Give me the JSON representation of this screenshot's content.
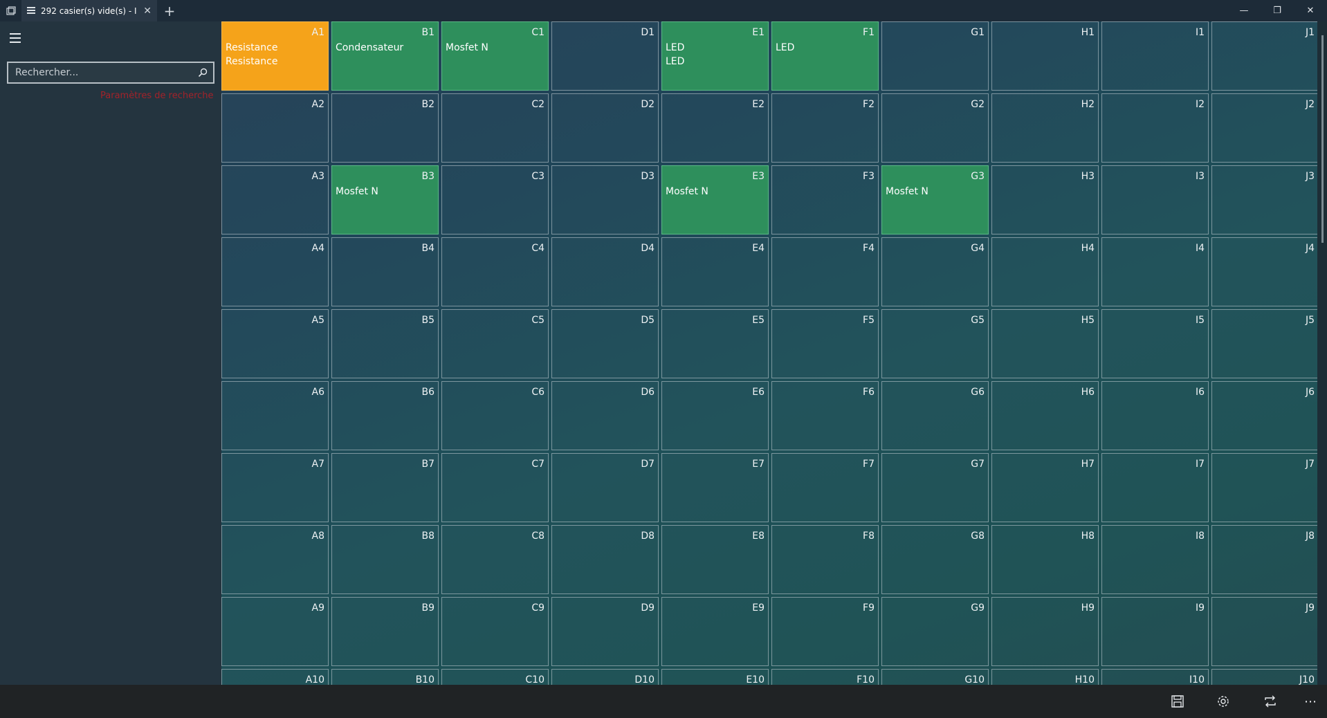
{
  "tab": {
    "title": "292 casier(s) vide(s) - I",
    "close_icon": "close-icon",
    "new_tab_icon": "plus-icon"
  },
  "window": {
    "minimize": "—",
    "restore": "❐",
    "close": "✕"
  },
  "sidebar": {
    "menu_icon": "hamburger-icon",
    "search_placeholder": "Rechercher...",
    "search_icon": "search-icon",
    "search_hint": "Paramètres de recherche"
  },
  "colors": {
    "occupied": "#2e8f5c",
    "highlight": "#f5a31a"
  },
  "grid": {
    "cells": [
      {
        "code": "A1",
        "items": [
          "Resistance",
          "Resistance"
        ],
        "state": "orange"
      },
      {
        "code": "B1",
        "items": [
          "Condensateur"
        ],
        "state": "green"
      },
      {
        "code": "C1",
        "items": [
          "Mosfet N"
        ],
        "state": "green"
      },
      {
        "code": "D1",
        "items": [],
        "state": "empty"
      },
      {
        "code": "E1",
        "items": [
          "LED",
          "LED"
        ],
        "state": "green"
      },
      {
        "code": "F1",
        "items": [
          "LED"
        ],
        "state": "green"
      },
      {
        "code": "G1",
        "items": [],
        "state": "empty"
      },
      {
        "code": "H1",
        "items": [],
        "state": "empty"
      },
      {
        "code": "I1",
        "items": [],
        "state": "empty"
      },
      {
        "code": "J1",
        "items": [],
        "state": "empty"
      },
      {
        "code": "A2",
        "items": [],
        "state": "empty"
      },
      {
        "code": "B2",
        "items": [],
        "state": "empty"
      },
      {
        "code": "C2",
        "items": [],
        "state": "empty"
      },
      {
        "code": "D2",
        "items": [],
        "state": "empty"
      },
      {
        "code": "E2",
        "items": [],
        "state": "empty"
      },
      {
        "code": "F2",
        "items": [],
        "state": "empty"
      },
      {
        "code": "G2",
        "items": [],
        "state": "empty"
      },
      {
        "code": "H2",
        "items": [],
        "state": "empty"
      },
      {
        "code": "I2",
        "items": [],
        "state": "empty"
      },
      {
        "code": "J2",
        "items": [],
        "state": "empty"
      },
      {
        "code": "A3",
        "items": [],
        "state": "empty"
      },
      {
        "code": "B3",
        "items": [
          "Mosfet N"
        ],
        "state": "green"
      },
      {
        "code": "C3",
        "items": [],
        "state": "empty"
      },
      {
        "code": "D3",
        "items": [],
        "state": "empty"
      },
      {
        "code": "E3",
        "items": [
          "Mosfet N"
        ],
        "state": "green"
      },
      {
        "code": "F3",
        "items": [],
        "state": "empty"
      },
      {
        "code": "G3",
        "items": [
          "Mosfet N"
        ],
        "state": "green"
      },
      {
        "code": "H3",
        "items": [],
        "state": "empty"
      },
      {
        "code": "I3",
        "items": [],
        "state": "empty"
      },
      {
        "code": "J3",
        "items": [],
        "state": "empty"
      },
      {
        "code": "A4",
        "items": [],
        "state": "empty"
      },
      {
        "code": "B4",
        "items": [],
        "state": "empty"
      },
      {
        "code": "C4",
        "items": [],
        "state": "empty"
      },
      {
        "code": "D4",
        "items": [],
        "state": "empty"
      },
      {
        "code": "E4",
        "items": [],
        "state": "empty"
      },
      {
        "code": "F4",
        "items": [],
        "state": "empty"
      },
      {
        "code": "G4",
        "items": [],
        "state": "empty"
      },
      {
        "code": "H4",
        "items": [],
        "state": "empty"
      },
      {
        "code": "I4",
        "items": [],
        "state": "empty"
      },
      {
        "code": "J4",
        "items": [],
        "state": "empty"
      },
      {
        "code": "A5",
        "items": [],
        "state": "empty"
      },
      {
        "code": "B5",
        "items": [],
        "state": "empty"
      },
      {
        "code": "C5",
        "items": [],
        "state": "empty"
      },
      {
        "code": "D5",
        "items": [],
        "state": "empty"
      },
      {
        "code": "E5",
        "items": [],
        "state": "empty"
      },
      {
        "code": "F5",
        "items": [],
        "state": "empty"
      },
      {
        "code": "G5",
        "items": [],
        "state": "empty"
      },
      {
        "code": "H5",
        "items": [],
        "state": "empty"
      },
      {
        "code": "I5",
        "items": [],
        "state": "empty"
      },
      {
        "code": "J5",
        "items": [],
        "state": "empty"
      },
      {
        "code": "A6",
        "items": [],
        "state": "empty"
      },
      {
        "code": "B6",
        "items": [],
        "state": "empty"
      },
      {
        "code": "C6",
        "items": [],
        "state": "empty"
      },
      {
        "code": "D6",
        "items": [],
        "state": "empty"
      },
      {
        "code": "E6",
        "items": [],
        "state": "empty"
      },
      {
        "code": "F6",
        "items": [],
        "state": "empty"
      },
      {
        "code": "G6",
        "items": [],
        "state": "empty"
      },
      {
        "code": "H6",
        "items": [],
        "state": "empty"
      },
      {
        "code": "I6",
        "items": [],
        "state": "empty"
      },
      {
        "code": "J6",
        "items": [],
        "state": "empty"
      },
      {
        "code": "A7",
        "items": [],
        "state": "empty"
      },
      {
        "code": "B7",
        "items": [],
        "state": "empty"
      },
      {
        "code": "C7",
        "items": [],
        "state": "empty"
      },
      {
        "code": "D7",
        "items": [],
        "state": "empty"
      },
      {
        "code": "E7",
        "items": [],
        "state": "empty"
      },
      {
        "code": "F7",
        "items": [],
        "state": "empty"
      },
      {
        "code": "G7",
        "items": [],
        "state": "empty"
      },
      {
        "code": "H7",
        "items": [],
        "state": "empty"
      },
      {
        "code": "I7",
        "items": [],
        "state": "empty"
      },
      {
        "code": "J7",
        "items": [],
        "state": "empty"
      },
      {
        "code": "A8",
        "items": [],
        "state": "empty"
      },
      {
        "code": "B8",
        "items": [],
        "state": "empty"
      },
      {
        "code": "C8",
        "items": [],
        "state": "empty"
      },
      {
        "code": "D8",
        "items": [],
        "state": "empty"
      },
      {
        "code": "E8",
        "items": [],
        "state": "empty"
      },
      {
        "code": "F8",
        "items": [],
        "state": "empty"
      },
      {
        "code": "G8",
        "items": [],
        "state": "empty"
      },
      {
        "code": "H8",
        "items": [],
        "state": "empty"
      },
      {
        "code": "I8",
        "items": [],
        "state": "empty"
      },
      {
        "code": "J8",
        "items": [],
        "state": "empty"
      },
      {
        "code": "A9",
        "items": [],
        "state": "empty"
      },
      {
        "code": "B9",
        "items": [],
        "state": "empty"
      },
      {
        "code": "C9",
        "items": [],
        "state": "empty"
      },
      {
        "code": "D9",
        "items": [],
        "state": "empty"
      },
      {
        "code": "E9",
        "items": [],
        "state": "empty"
      },
      {
        "code": "F9",
        "items": [],
        "state": "empty"
      },
      {
        "code": "G9",
        "items": [],
        "state": "empty"
      },
      {
        "code": "H9",
        "items": [],
        "state": "empty"
      },
      {
        "code": "I9",
        "items": [],
        "state": "empty"
      },
      {
        "code": "J9",
        "items": [],
        "state": "empty"
      },
      {
        "code": "A10",
        "items": [],
        "state": "empty"
      },
      {
        "code": "B10",
        "items": [],
        "state": "empty"
      },
      {
        "code": "C10",
        "items": [],
        "state": "empty"
      },
      {
        "code": "D10",
        "items": [],
        "state": "empty"
      },
      {
        "code": "E10",
        "items": [],
        "state": "empty"
      },
      {
        "code": "F10",
        "items": [],
        "state": "empty"
      },
      {
        "code": "G10",
        "items": [],
        "state": "empty"
      },
      {
        "code": "H10",
        "items": [],
        "state": "empty"
      },
      {
        "code": "I10",
        "items": [],
        "state": "empty"
      },
      {
        "code": "J10",
        "items": [],
        "state": "empty"
      }
    ]
  },
  "commands": [
    {
      "name": "save-button",
      "icon": "save-icon"
    },
    {
      "name": "settings-button",
      "icon": "gear-icon"
    },
    {
      "name": "sync-button",
      "icon": "repeat-icon"
    },
    {
      "name": "more-button",
      "icon": "more-icon"
    }
  ]
}
